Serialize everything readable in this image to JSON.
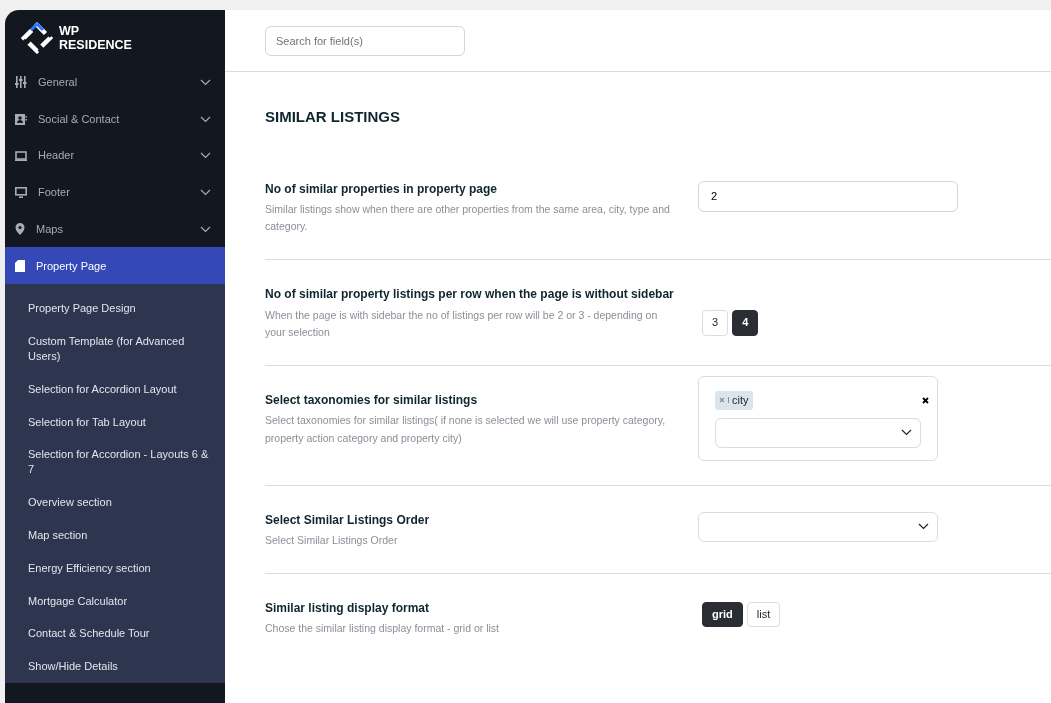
{
  "brand": {
    "line_1": "WP",
    "line_2": "RESIDENCE"
  },
  "sidebar": {
    "items": [
      {
        "label": "General",
        "kind": "sliders",
        "selected": false,
        "expanded": false
      },
      {
        "label": "Social & Contact",
        "kind": "contact",
        "selected": false,
        "expanded": false
      },
      {
        "label": "Header",
        "kind": "laptop",
        "selected": false,
        "expanded": false
      },
      {
        "label": "Footer",
        "kind": "monitor",
        "selected": false,
        "expanded": false
      },
      {
        "label": "Maps",
        "kind": "pin",
        "selected": false,
        "expanded": false
      },
      {
        "label": "Property Page",
        "kind": "document",
        "selected": true,
        "expanded": true,
        "children": [
          {
            "label": "Property Page Design"
          },
          {
            "label": "Custom Template (for Advanced Users)"
          },
          {
            "label": "Selection for Accordion Layout"
          },
          {
            "label": "Selection for Tab Layout"
          },
          {
            "label": "Selection for Accordion - Layouts 6 & 7"
          },
          {
            "label": "Overview section"
          },
          {
            "label": "Map section"
          },
          {
            "label": "Energy Efficiency section"
          },
          {
            "label": "Mortgage Calculator"
          },
          {
            "label": "Contact & Schedule Tour"
          },
          {
            "label": "Show/Hide Details"
          }
        ]
      }
    ]
  },
  "search": {
    "placeholder": "Search for field(s)"
  },
  "section_title": "SIMILAR LISTINGS",
  "settings": [
    {
      "kind": "number",
      "title": "No of similar properties in property page",
      "description": "Similar listings show when there are other properties from the same area, city, type and category.",
      "value": "2"
    },
    {
      "kind": "toggle",
      "title": "No of similar property listings per row when the page is without sidebar",
      "description": "When the page is with sidebar the no of listings per row will be 2 or 3 - depending on your selection",
      "options": [
        {
          "label": "3",
          "selected": false
        },
        {
          "label": "4",
          "selected": true
        }
      ]
    },
    {
      "kind": "multiselect",
      "title": "Select taxonomies for similar listings",
      "description": "Select taxonomies for similar listings( if none is selected we will use property category, property action category and property city)",
      "tags": [
        "city"
      ]
    },
    {
      "kind": "select",
      "title": "Select Similar Listings Order",
      "description": "Select Similar Listings Order"
    },
    {
      "kind": "toggle",
      "title": "Similar listing display format",
      "description": "Chose the similar listing display format - grid or list",
      "options": [
        {
          "label": "grid",
          "selected": true
        },
        {
          "label": "list",
          "selected": false
        }
      ]
    }
  ]
}
